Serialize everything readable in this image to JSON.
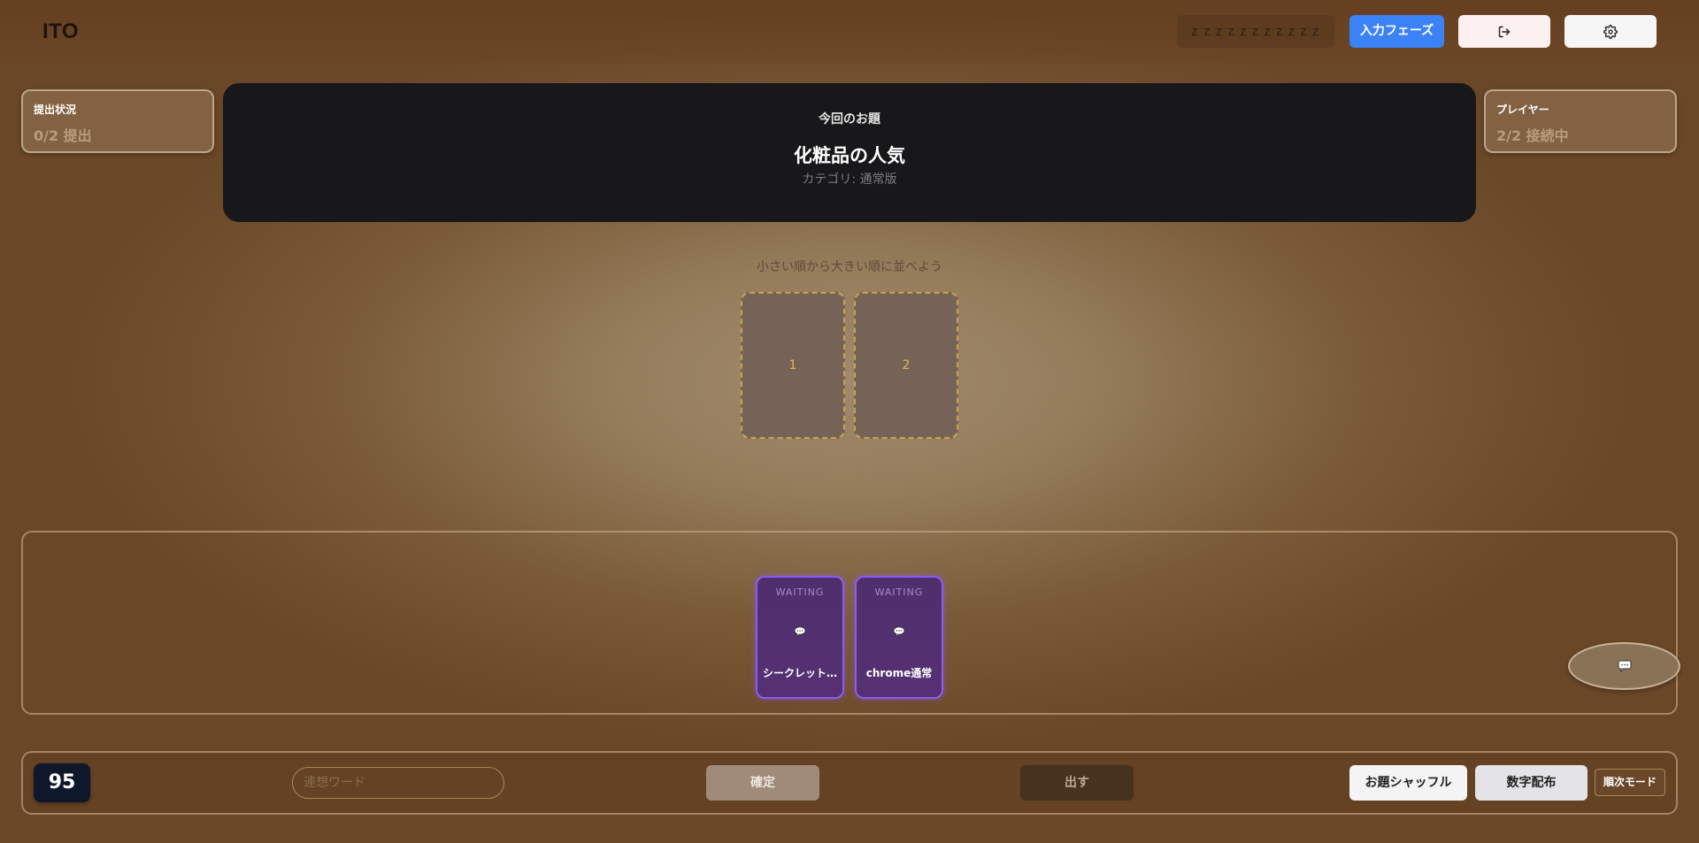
{
  "header": {
    "logo": "ITO",
    "room_name": "z z z z z z z z z z z",
    "phase_label": "入力フェーズ",
    "exit_icon": "logout-icon",
    "settings_icon": "gear-icon"
  },
  "submission_panel": {
    "title": "提出状況",
    "value": "0/2 提出"
  },
  "players_panel": {
    "title": "プレイヤー",
    "value": "2/2 接続中"
  },
  "topic": {
    "label": "今回のお題",
    "title": "化粧品の人気",
    "category": "カテゴリ: 通常版"
  },
  "board": {
    "instruction": "小さい順から大きい順に並べよう",
    "slots": [
      "1",
      "2"
    ]
  },
  "hand": {
    "hint": "",
    "cards": [
      {
        "status": "WAITING",
        "name": "シークレット…",
        "icon": "speech-bubble-icon"
      },
      {
        "status": "WAITING",
        "name": "chrome通常",
        "icon": "speech-bubble-icon"
      }
    ]
  },
  "chat": {
    "icon": "chat-icon"
  },
  "footer": {
    "my_number": "95",
    "word_placeholder": "連想ワード",
    "confirm_label": "確定",
    "play_label": "出す",
    "shuffle_label": "お題シャッフル",
    "deal_label": "数字配布",
    "mode_label": "順次モード"
  },
  "colors": {
    "accent_blue": "#3b82f6",
    "card_purple": "#8b5cf6",
    "topic_bg": "#18181b",
    "slot_border": "#c9a24a"
  }
}
